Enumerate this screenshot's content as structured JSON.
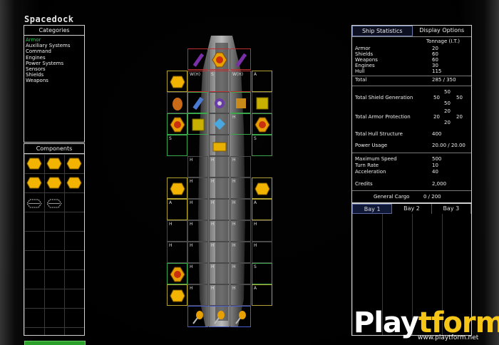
{
  "title": "Spacedock",
  "categories": {
    "header": "Categories",
    "items": [
      "Armor",
      "Auxiliary Systems",
      "Command",
      "Engines",
      "Power Systems",
      "Sensors",
      "Shields",
      "Weapons"
    ],
    "selected": 0
  },
  "components": {
    "header": "Components"
  },
  "stats": {
    "tab_ship": "Ship Statistics",
    "tab_display": "Display Options",
    "tonnage_label": "Tonnage (I.T.)",
    "armor_label": "Armor",
    "armor": "20",
    "shields_label": "Shields",
    "shields": "60",
    "weapons_label": "Weapons",
    "weapons": "60",
    "engines_label": "Engines",
    "engines": "30",
    "hull_label": "Hull",
    "hull": "115",
    "total_label": "Total",
    "total": "285 / 350",
    "shield_gen_label": "Total Shield Generation",
    "sg_a": "50",
    "sg_b": "50",
    "sg_c": "50",
    "sg_d": "50",
    "armor_prot_label": "Total Armor Protection",
    "ap_a": "20",
    "ap_b": "20",
    "ap_c": "20",
    "ap_d": "20",
    "hull_struct_label": "Total Hull Structure",
    "hull_struct": "400",
    "power_label": "Power Usage",
    "power": "20.00 / 20.00",
    "max_speed_label": "Maximum Speed",
    "max_speed": "500",
    "turn_rate_label": "Turn Rate",
    "turn_rate": "10",
    "accel_label": "Acceleration",
    "accel": "40",
    "credits_label": "Credits",
    "credits": "2,000",
    "cargo_label": "General Cargo",
    "cargo": "0 / 200"
  },
  "bays": [
    "Bay 1",
    "Bay 2",
    "Bay 3"
  ],
  "slot_labels": {
    "wh": "W(H)",
    "s": "S",
    "a": "A",
    "h": "H"
  },
  "watermark": {
    "logo_a": "Play",
    "logo_b": "tform",
    "url": "www.playtform.net"
  },
  "colors": {
    "selected_category": "#1fd64a",
    "gold": "#f2b400",
    "red_frame": "#c03030",
    "green_frame": "#3aa84a"
  }
}
